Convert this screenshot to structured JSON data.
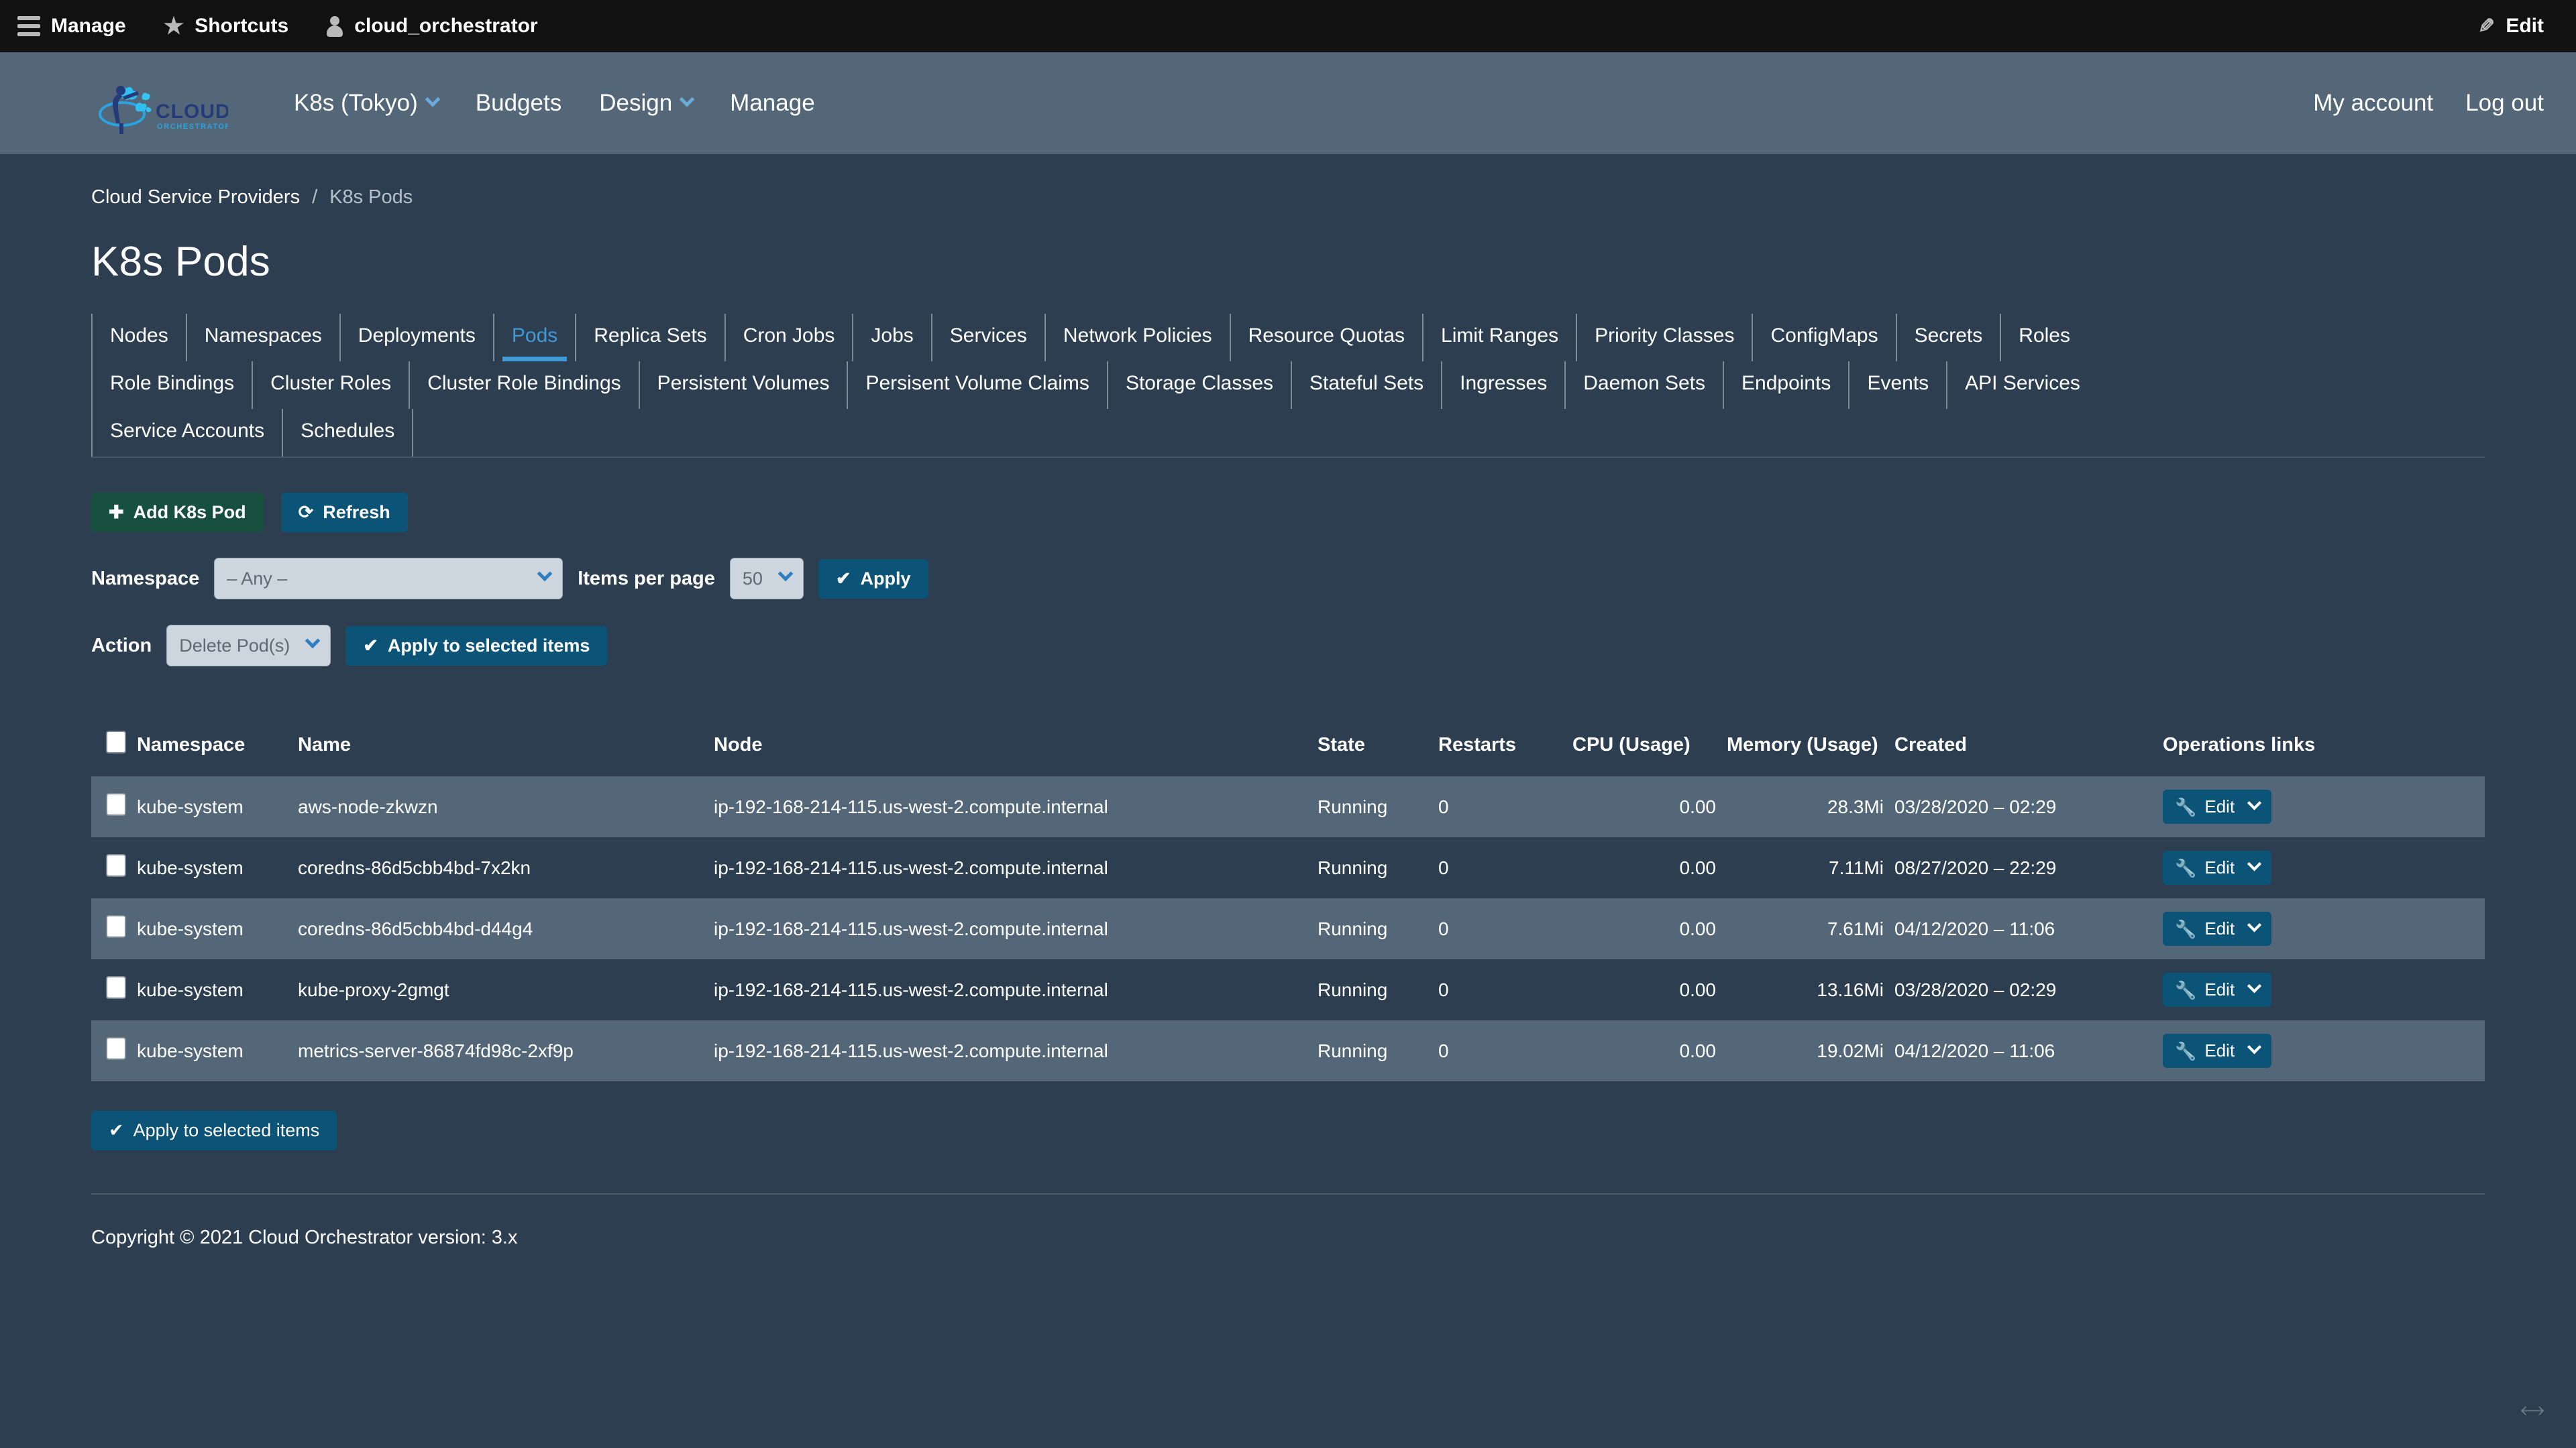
{
  "admin_bar": {
    "manage": "Manage",
    "shortcuts": "Shortcuts",
    "user": "cloud_orchestrator",
    "edit": "Edit"
  },
  "header": {
    "logo_text": "CLOUD",
    "logo_subtext": "ORCHESTRATOR",
    "nav": [
      {
        "label": "K8s (Tokyo)",
        "has_caret": true
      },
      {
        "label": "Budgets",
        "has_caret": false
      },
      {
        "label": "Design",
        "has_caret": true
      },
      {
        "label": "Manage",
        "has_caret": false
      }
    ],
    "right": [
      {
        "label": "My account"
      },
      {
        "label": "Log out"
      }
    ]
  },
  "breadcrumb": {
    "parent": "Cloud Service Providers",
    "separator": "/",
    "current": "K8s Pods"
  },
  "page_title": "K8s Pods",
  "tabs": [
    [
      {
        "label": "Nodes",
        "active": false
      },
      {
        "label": "Namespaces",
        "active": false
      },
      {
        "label": "Deployments",
        "active": false
      },
      {
        "label": "Pods",
        "active": true
      },
      {
        "label": "Replica Sets",
        "active": false
      },
      {
        "label": "Cron Jobs",
        "active": false
      },
      {
        "label": "Jobs",
        "active": false
      },
      {
        "label": "Services",
        "active": false
      },
      {
        "label": "Network Policies",
        "active": false
      },
      {
        "label": "Resource Quotas",
        "active": false
      },
      {
        "label": "Limit Ranges",
        "active": false
      },
      {
        "label": "Priority Classes",
        "active": false
      },
      {
        "label": "ConfigMaps",
        "active": false
      },
      {
        "label": "Secrets",
        "active": false
      },
      {
        "label": "Roles",
        "active": false
      }
    ],
    [
      {
        "label": "Role Bindings",
        "active": false
      },
      {
        "label": "Cluster Roles",
        "active": false
      },
      {
        "label": "Cluster Role Bindings",
        "active": false
      },
      {
        "label": "Persistent Volumes",
        "active": false
      },
      {
        "label": "Persisent Volume Claims",
        "active": false
      },
      {
        "label": "Storage Classes",
        "active": false
      },
      {
        "label": "Stateful Sets",
        "active": false
      },
      {
        "label": "Ingresses",
        "active": false
      },
      {
        "label": "Daemon Sets",
        "active": false
      },
      {
        "label": "Endpoints",
        "active": false
      },
      {
        "label": "Events",
        "active": false
      },
      {
        "label": "API Services",
        "active": false
      }
    ],
    [
      {
        "label": "Service Accounts",
        "active": false
      },
      {
        "label": "Schedules",
        "active": false
      }
    ]
  ],
  "toolbar": {
    "add_label": "Add K8s Pod",
    "add_icon": "plus-icon",
    "refresh_label": "Refresh",
    "refresh_icon": "refresh-icon"
  },
  "filters": {
    "namespace_label": "Namespace",
    "namespace_value": "– Any –",
    "items_per_page_label": "Items per page",
    "items_per_page_value": "50",
    "apply_label": "Apply",
    "action_label": "Action",
    "action_value": "Delete Pod(s)",
    "apply_selected_label": "Apply to selected items"
  },
  "table": {
    "columns": [
      "Namespace",
      "Name",
      "Node",
      "State",
      "Restarts",
      "CPU (Usage)",
      "Memory (Usage)",
      "Created",
      "Operations links"
    ],
    "row_action_label": "Edit",
    "rows": [
      {
        "namespace": "kube-system",
        "name": "aws-node-zkwzn",
        "node": "ip-192-168-214-115.us-west-2.compute.internal",
        "state": "Running",
        "restarts": "0",
        "cpu": "0.00",
        "memory": "28.3Mi",
        "created": "03/28/2020 – 02:29"
      },
      {
        "namespace": "kube-system",
        "name": "coredns-86d5cbb4bd-7x2kn",
        "node": "ip-192-168-214-115.us-west-2.compute.internal",
        "state": "Running",
        "restarts": "0",
        "cpu": "0.00",
        "memory": "7.11Mi",
        "created": "08/27/2020 – 22:29"
      },
      {
        "namespace": "kube-system",
        "name": "coredns-86d5cbb4bd-d44g4",
        "node": "ip-192-168-214-115.us-west-2.compute.internal",
        "state": "Running",
        "restarts": "0",
        "cpu": "0.00",
        "memory": "7.61Mi",
        "created": "04/12/2020 – 11:06"
      },
      {
        "namespace": "kube-system",
        "name": "kube-proxy-2gmgt",
        "node": "ip-192-168-214-115.us-west-2.compute.internal",
        "state": "Running",
        "restarts": "0",
        "cpu": "0.00",
        "memory": "13.16Mi",
        "created": "03/28/2020 – 02:29"
      },
      {
        "namespace": "kube-system",
        "name": "metrics-server-86874fd98c-2xf9p",
        "node": "ip-192-168-214-115.us-west-2.compute.internal",
        "state": "Running",
        "restarts": "0",
        "cpu": "0.00",
        "memory": "19.02Mi",
        "created": "04/12/2020 – 11:06"
      }
    ]
  },
  "footer": {
    "copyright": "Copyright © 2021 Cloud Orchestrator version: 3.x"
  },
  "colors": {
    "admin_bar_bg": "#111112",
    "header_bg": "#546778",
    "page_bg": "#2c3e50",
    "accent_blue": "#3f9ad6",
    "button_blue": "#0c5378",
    "button_green": "#18503f",
    "row_alt_bg": "#546778",
    "select_bg": "#cdd6de"
  }
}
